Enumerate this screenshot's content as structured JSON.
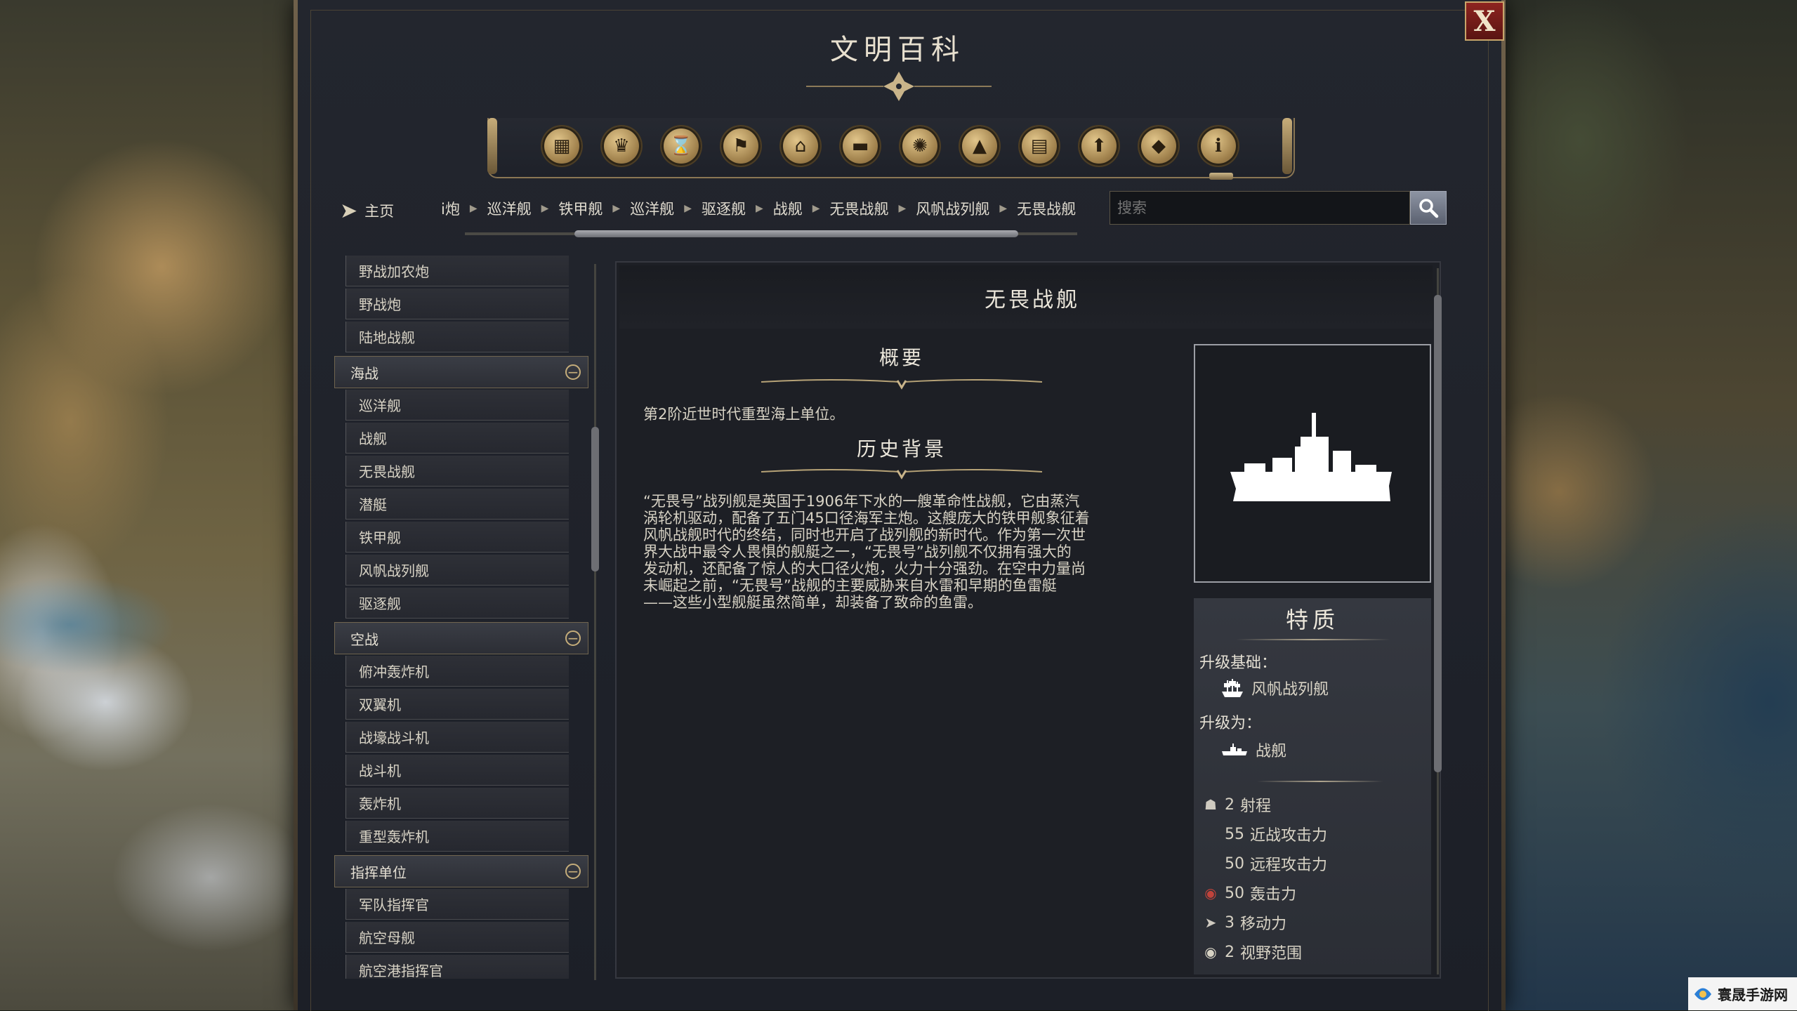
{
  "window": {
    "title": "文明百科",
    "close_label": "X"
  },
  "toolbar": {
    "icons": [
      {
        "name": "civilopedia-units-icon",
        "glyph": "▦"
      },
      {
        "name": "trophy-icon",
        "glyph": "♛"
      },
      {
        "name": "hourglass-icon",
        "glyph": "⌛"
      },
      {
        "name": "flag-icon",
        "glyph": "⚑"
      },
      {
        "name": "temple-icon",
        "glyph": "⌂"
      },
      {
        "name": "book-icon",
        "glyph": "▬"
      },
      {
        "name": "atom-icon",
        "glyph": "✺"
      },
      {
        "name": "mountain-icon",
        "glyph": "▲"
      },
      {
        "name": "buildings-icon",
        "glyph": "▤"
      },
      {
        "name": "upgrade-arrow-icon",
        "glyph": "⬆"
      },
      {
        "name": "resource-icon",
        "glyph": "◆"
      },
      {
        "name": "info-icon",
        "glyph": "ℹ"
      }
    ]
  },
  "nav": {
    "home_label": "主页",
    "breadcrumbs": [
      "i炮",
      "巡洋舰",
      "铁甲舰",
      "巡洋舰",
      "驱逐舰",
      "战舰",
      "无畏战舰",
      "风帆战列舰",
      "无畏战舰"
    ],
    "search_placeholder": "搜索"
  },
  "sidebar": {
    "items_top": [
      "野战加农炮",
      "野战炮",
      "陆地战舰"
    ],
    "categories": [
      {
        "label": "海战",
        "items": [
          "巡洋舰",
          "战舰",
          "无畏战舰",
          "潜艇",
          "铁甲舰",
          "风帆战列舰",
          "驱逐舰"
        ]
      },
      {
        "label": "空战",
        "items": [
          "俯冲轰炸机",
          "双翼机",
          "战壕战斗机",
          "战斗机",
          "轰炸机",
          "重型轰炸机"
        ]
      },
      {
        "label": "指挥单位",
        "items": [
          "军队指挥官",
          "航空母舰",
          "航空港指挥官"
        ]
      }
    ]
  },
  "detail": {
    "unit_name": "无畏战舰",
    "summary_title": "概要",
    "summary_text": "第2阶近世时代重型海上单位。",
    "history_title": "历史背景",
    "history_text": "“无畏号”战列舰是英国于1906年下水的一艘革命性战舰，它由蒸汽\n涡轮机驱动，配备了五门45口径海军主炮。这艘庞大的铁甲舰象征着\n风帆战舰时代的终结，同时也开启了战列舰的新时代。作为第一次世\n界大战中最令人畏惧的舰艇之一，“无畏号”战列舰不仅拥有强大的\n发动机，还配备了惊人的大口径火炮，火力十分强劲。在空中力量尚\n未崛起之前，“无畏号”战舰的主要威胁来自水雷和早期的鱼雷艇\n——这些小型舰艇虽然简单，却装备了致命的鱼雷。"
  },
  "traits": {
    "title": "特质",
    "upgrade_from_label": "升级基础：",
    "upgrade_from_unit": "风帆战列舰",
    "upgrade_to_label": "升级为：",
    "upgrade_to_unit": "战舰",
    "stats": [
      {
        "icon": "range-icon",
        "value": "2",
        "label": "射程"
      },
      {
        "icon": "",
        "value": "55",
        "label": "近战攻击力"
      },
      {
        "icon": "",
        "value": "50",
        "label": "远程攻击力"
      },
      {
        "icon": "bombard-icon",
        "value": "50",
        "label": "轰击力"
      },
      {
        "icon": "movement-icon",
        "value": "3",
        "label": "移动力"
      },
      {
        "icon": "vision-icon",
        "value": "2",
        "label": "视野范围"
      }
    ]
  },
  "watermark": {
    "text": "寰晟手游网"
  },
  "colors": {
    "accent_gold": "#c5ad7a",
    "close_red": "#8e2420",
    "panel_dark": "#1d1f25"
  }
}
